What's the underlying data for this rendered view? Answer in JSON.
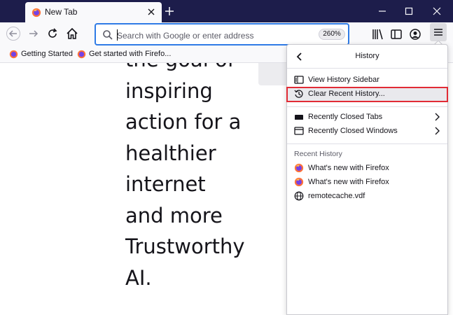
{
  "tab": {
    "title": "New Tab"
  },
  "urlbar": {
    "placeholder": "Search with Google or enter address",
    "zoom": "260%"
  },
  "bookmarks": [
    {
      "label": "Getting Started"
    },
    {
      "label": "Get started with Firefo..."
    }
  ],
  "page": {
    "lines": [
      "the goal of",
      "inspiring",
      "action for a",
      "healthier",
      "internet",
      "and more",
      "Trustworthy",
      "AI."
    ]
  },
  "history_panel": {
    "title": "History",
    "items": [
      {
        "label": "View History Sidebar",
        "icon": "sidebar-icon"
      },
      {
        "label": "Clear Recent History...",
        "icon": "clear-history-icon",
        "highlighted": true
      },
      {
        "label": "Recently Closed Tabs",
        "icon": "closed-tabs-icon",
        "submenu": true
      },
      {
        "label": "Recently Closed Windows",
        "icon": "closed-windows-icon",
        "submenu": true
      }
    ],
    "recent_label": "Recent History",
    "recent": [
      {
        "label": "What's new with Firefox",
        "icon": "firefox-icon"
      },
      {
        "label": "What's new with Firefox",
        "icon": "firefox-icon"
      },
      {
        "label": "remotecache.vdf",
        "icon": "globe-icon"
      }
    ]
  },
  "colors": {
    "titlebar": "#1d1d4b",
    "accent": "#2f7be6",
    "highlight_outline": "#e12b35"
  }
}
